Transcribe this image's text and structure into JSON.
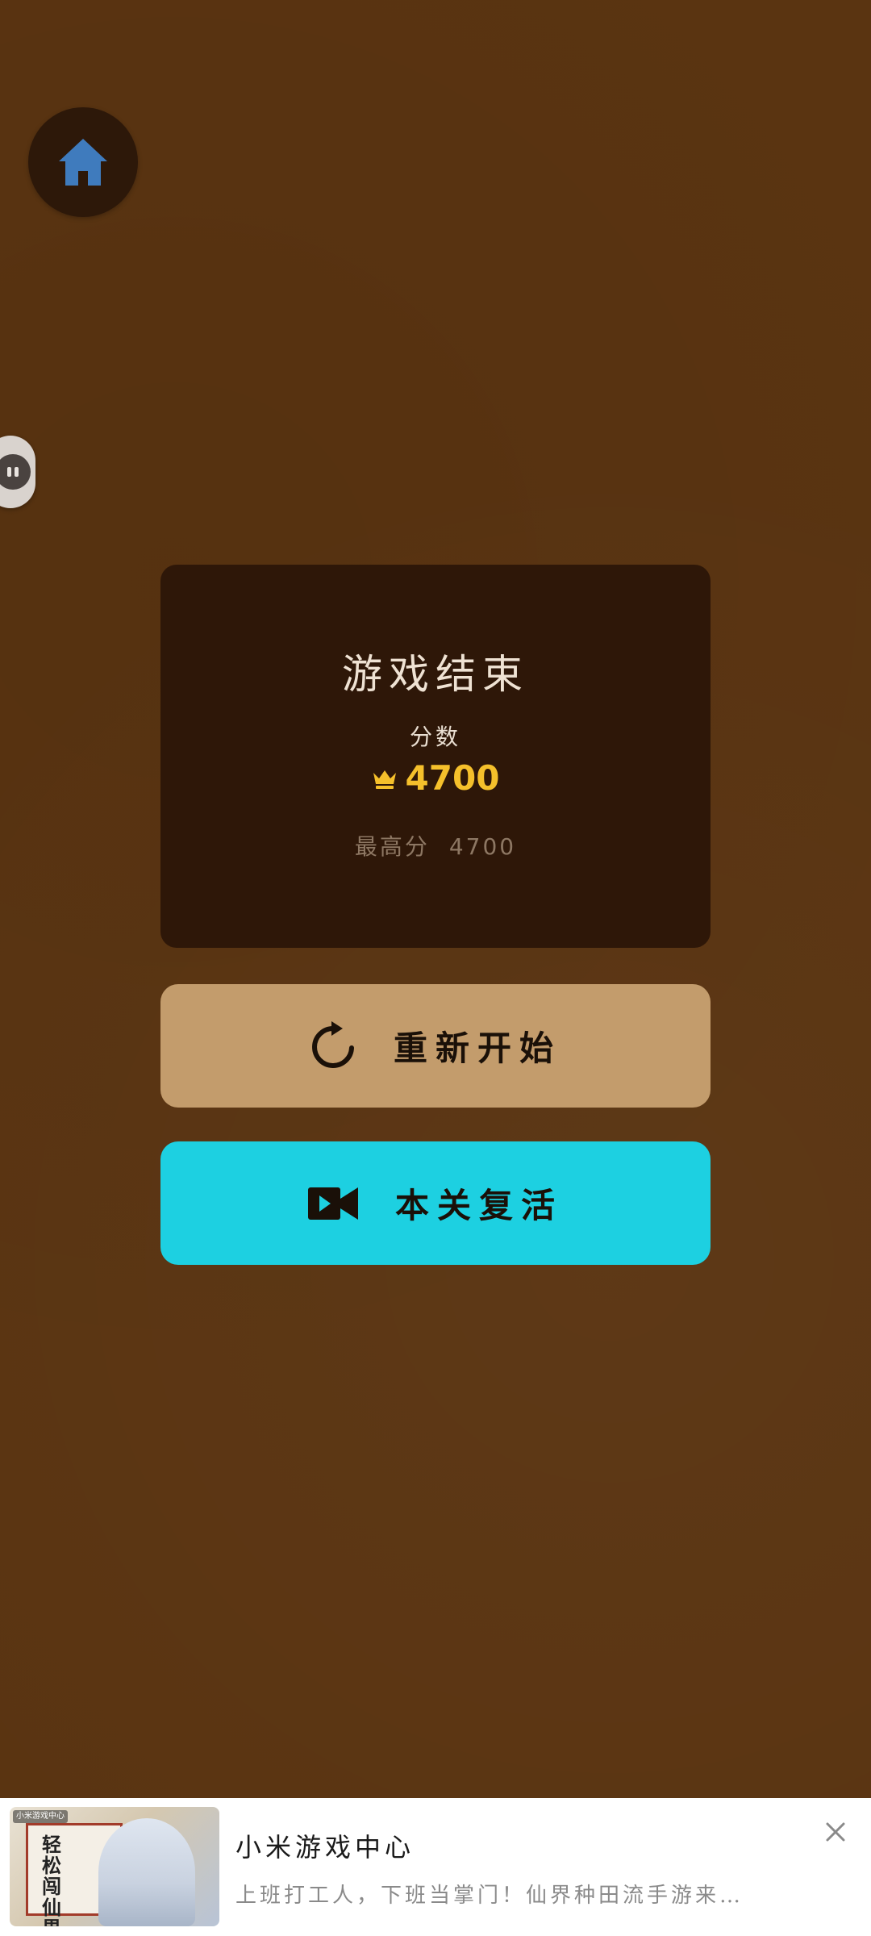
{
  "game_over": {
    "title": "游戏结束",
    "score_label": "分数",
    "score_value": "4700",
    "best_label": "最高分",
    "best_value": "4700"
  },
  "buttons": {
    "restart_label": "重新开始",
    "revive_label": "本关复活"
  },
  "icons": {
    "home": "home-icon",
    "restart": "refresh-icon",
    "revive": "video-camera-icon",
    "score": "crown-icon",
    "close": "close-icon"
  },
  "ad": {
    "title": "小米游戏中心",
    "description": "上班打工人，下班当掌门！仙界种田流手游来…",
    "thumbnail_tag": "小米游戏中心",
    "thumbnail_text": "轻松闯仙界"
  },
  "colors": {
    "background": "#5a3411",
    "card": "#2e1708",
    "score": "#f5c02b",
    "restart_button": "#c39c6c",
    "revive_button": "#1dd0e1",
    "home_icon": "#3f7bbd"
  }
}
